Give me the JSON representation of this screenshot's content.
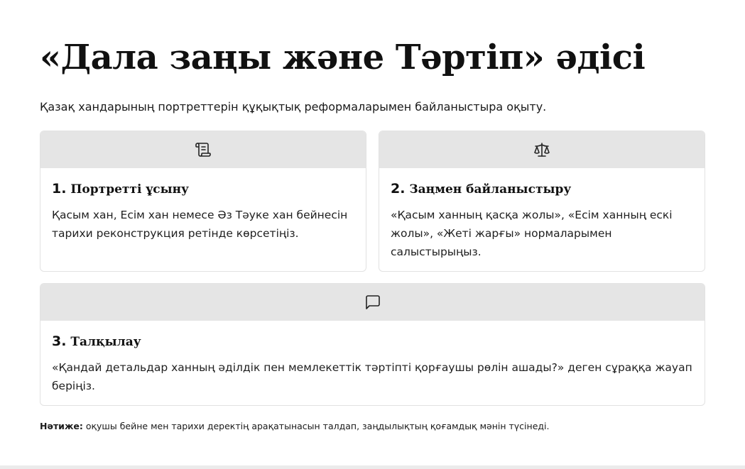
{
  "title": "«Дала заңы және Тәртіп» әдісі",
  "subtitle": "Қазақ хандарының портреттерін құқықтық реформаларымен байланыстыра оқыту.",
  "steps": [
    {
      "icon": "scroll-icon",
      "number": "1.",
      "title": "Портретті ұсыну",
      "text": "Қасым хан, Есім хан немесе Әз Тәуке хан бейнесін тарихи реконструкция ретінде көрсетіңіз."
    },
    {
      "icon": "scale-icon",
      "number": "2.",
      "title": "Заңмен байланыстыру",
      "text": "«Қасым ханның қасқа жолы», «Есім ханның ескі жолы», «Жеті жарғы» нормаларымен салыстырыңыз."
    },
    {
      "icon": "message-icon",
      "number": "3.",
      "title": "Талқылау",
      "text": "«Қандай детальдар ханның әділдік пен мемлекеттік тәртіпті қорғаушы рөлін ашады?» деген сұраққа жауап беріңіз."
    }
  ],
  "result": {
    "label": "Нәтиже:",
    "text": " оқушы бейне мен тарихи деректің арақатынасын талдап, заңдылықтың қоғамдық мәнін түсінеді."
  },
  "colors": {
    "card_header_bg": "#e5e5e5",
    "card_border": "#e2e2e2",
    "text": "#111111"
  }
}
